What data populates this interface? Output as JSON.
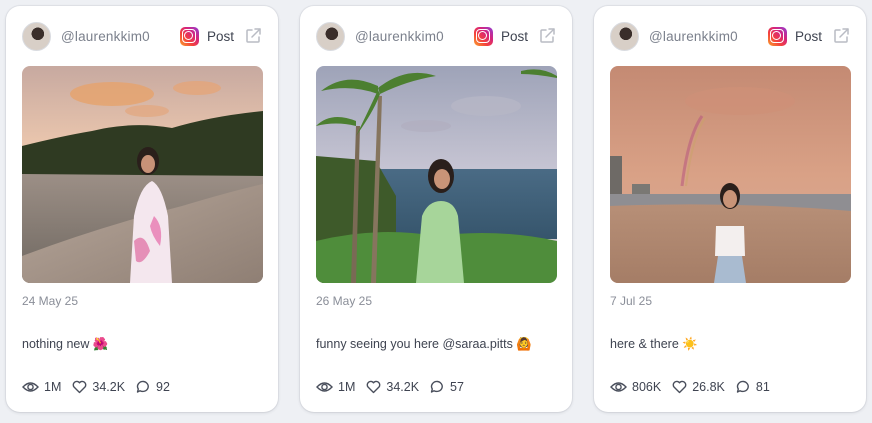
{
  "posts": [
    {
      "handle": "@laurenkkim0",
      "post_label": "Post",
      "date": "24 May 25",
      "caption": "nothing new 🌺",
      "views": "1M",
      "likes": "34.2K",
      "comments": "92",
      "image": "woman-in-pink-floral-dress-on-beach-at-sunset"
    },
    {
      "handle": "@laurenkkim0",
      "post_label": "Post",
      "date": "26 May 25",
      "caption": "funny seeing you here @saraa.pitts 🙆",
      "views": "1M",
      "likes": "34.2K",
      "comments": "57",
      "image": "woman-in-green-dress-under-palm-trees-by-ocean"
    },
    {
      "handle": "@laurenkkim0",
      "post_label": "Post",
      "date": "7 Jul 25",
      "caption": "here & there ☀️",
      "views": "806K",
      "likes": "26.8K",
      "comments": "81",
      "image": "woman-on-beach-with-rainbow-in-pink-sky"
    }
  ],
  "colors": {
    "card_bg": "#ffffff",
    "page_bg": "#eef0f4",
    "muted_text": "#8a8e98",
    "text": "#3f4451"
  }
}
